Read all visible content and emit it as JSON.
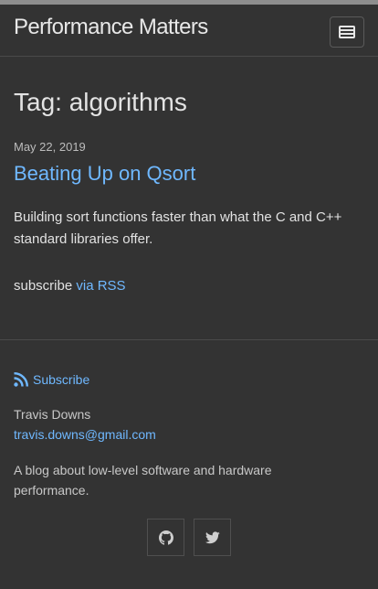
{
  "header": {
    "site_title": "Performance Matters",
    "menu_icon": "hamburger-icon"
  },
  "page": {
    "tag_title": "Tag: algorithms"
  },
  "post": {
    "date": "May 22, 2019",
    "title": "Beating Up on Qsort",
    "excerpt": "Building sort functions faster than what the C and C++ standard libraries offer."
  },
  "subscribe": {
    "prefix": "subscribe",
    "link_label": "via RSS"
  },
  "footer": {
    "subscribe_label": "Subscribe",
    "subscribe_icon": "rss-icon",
    "author_name": "Travis Downs",
    "author_email": "travis.downs@gmail.com",
    "description": "A blog about low-level software and hardware performance.",
    "social": [
      {
        "icon": "github-icon"
      },
      {
        "icon": "twitter-icon"
      }
    ]
  },
  "colors": {
    "background": "#333333",
    "link": "#6fb8ff",
    "text": "#e2e2e2",
    "muted": "#bcbcbc",
    "border": "#4a4a4a"
  }
}
